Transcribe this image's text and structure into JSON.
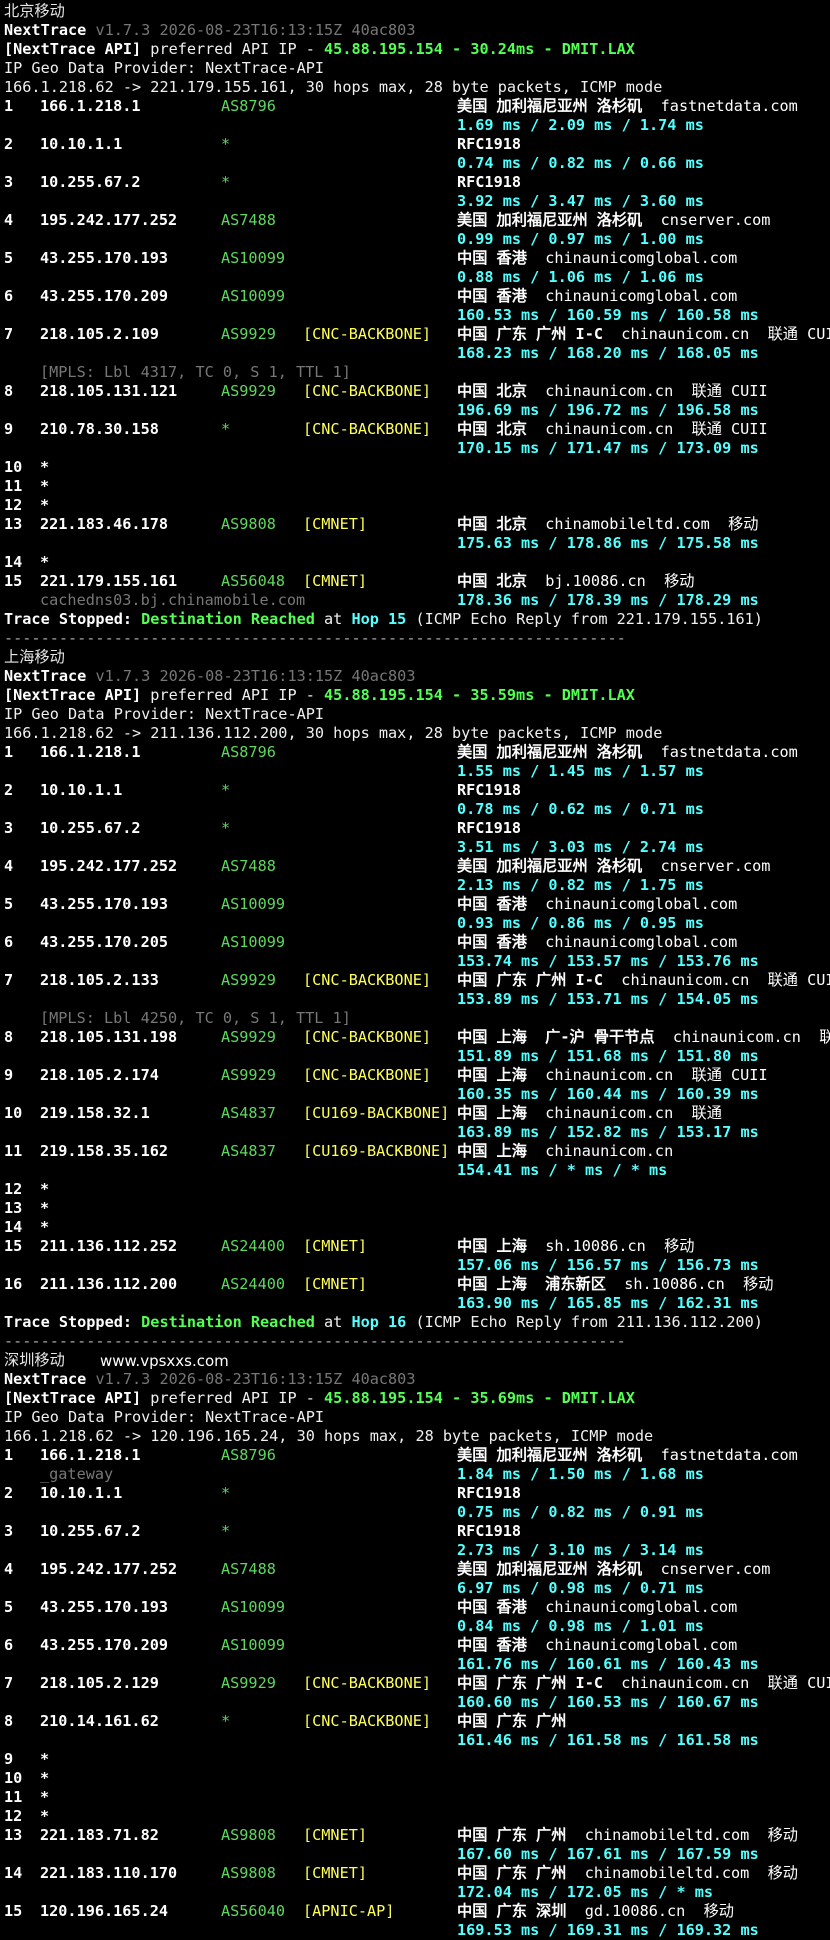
{
  "colors": {
    "bg": "#000000",
    "asn": "#5fd75f",
    "tag": "#ffff54",
    "latency": "#54ffff",
    "dim": "#777777"
  },
  "watermark": "www.vpsxxs.com",
  "sections": [
    {
      "title": "北京移动",
      "version": "v1.7.3 2026-08-23T16:13:15Z 40ac803",
      "api_prefix": "[NextTrace API]",
      "api_mid": " preferred API IP - ",
      "api_value": "45.88.195.154 - 30.24ms - DMIT.LAX",
      "geo_provider": "IP Geo Data Provider: NextTrace-API",
      "header": "166.1.218.62 -> 221.179.155.161, 30 hops max, 28 byte packets, ICMP mode",
      "hops": [
        {
          "n": "1",
          "ip": "166.1.218.1",
          "as": "AS8796",
          "tag": "",
          "geo": "美国 加利福尼亚州 洛杉矶",
          "host": "fastnetdata.com",
          "lat": "1.69 ms / 2.09 ms / 1.74 ms"
        },
        {
          "n": "2",
          "ip": "10.10.1.1",
          "as": "*",
          "tag": "",
          "geo": "RFC1918",
          "host": "",
          "lat": "0.74 ms / 0.82 ms / 0.66 ms"
        },
        {
          "n": "3",
          "ip": "10.255.67.2",
          "as": "*",
          "tag": "",
          "geo": "RFC1918",
          "host": "",
          "lat": "3.92 ms / 3.47 ms / 3.60 ms"
        },
        {
          "n": "4",
          "ip": "195.242.177.252",
          "as": "AS7488",
          "tag": "",
          "geo": "美国 加利福尼亚州 洛杉矶",
          "host": "cnserver.com",
          "lat": "0.99 ms / 0.97 ms / 1.00 ms"
        },
        {
          "n": "5",
          "ip": "43.255.170.193",
          "as": "AS10099",
          "tag": "",
          "geo": "中国 香港",
          "host": "chinaunicomglobal.com",
          "lat": "0.88 ms / 1.06 ms / 1.06 ms"
        },
        {
          "n": "6",
          "ip": "43.255.170.209",
          "as": "AS10099",
          "tag": "",
          "geo": "中国 香港",
          "host": "chinaunicomglobal.com",
          "lat": "160.53 ms / 160.59 ms / 160.58 ms"
        },
        {
          "n": "7",
          "ip": "218.105.2.109",
          "as": "AS9929",
          "tag": "[CNC-BACKBONE]",
          "geo": "中国 广东 广州 I-C",
          "host": "chinaunicom.cn  联通 CUII",
          "lat": "168.23 ms / 168.20 ms / 168.05 ms"
        },
        {
          "n": "8",
          "ip": "218.105.131.121",
          "as": "AS9929",
          "tag": "[CNC-BACKBONE]",
          "geo": "中国 北京",
          "host": "chinaunicom.cn  联通 CUII",
          "lat": "196.69 ms / 196.72 ms / 196.58 ms",
          "mpls": "[MPLS: Lbl 4317, TC 0, S 1, TTL 1]"
        },
        {
          "n": "9",
          "ip": "210.78.30.158",
          "as": "*",
          "tag": "[CNC-BACKBONE]",
          "geo": "中国 北京",
          "host": "chinaunicom.cn  联通 CUII",
          "lat": "170.15 ms / 171.47 ms / 173.09 ms"
        },
        {
          "n": "10",
          "ip": "*",
          "star": true
        },
        {
          "n": "11",
          "ip": "*",
          "star": true
        },
        {
          "n": "12",
          "ip": "*",
          "star": true
        },
        {
          "n": "13",
          "ip": "221.183.46.178",
          "as": "AS9808",
          "tag": "[CMNET]",
          "geo": "中国 北京",
          "host": "chinamobileltd.com  移动",
          "lat": "175.63 ms / 178.86 ms / 175.58 ms"
        },
        {
          "n": "14",
          "ip": "*",
          "star": true
        },
        {
          "n": "15",
          "ip": "221.179.155.161",
          "as": "AS56048",
          "tag": "[CMNET]",
          "geo": "中国 北京",
          "host": "bj.10086.cn  移动",
          "lat": "178.36 ms / 178.39 ms / 178.29 ms",
          "rdns": "cachedns03.bj.chinamobile.com"
        }
      ],
      "stop_a": "Trace Stopped: ",
      "stop_b": "Destination Reached",
      "stop_c": " at ",
      "stop_d": "Hop 15",
      "stop_e": " (ICMP Echo Reply from 221.179.155.161)",
      "separator": "--------------------------------------------------------------------"
    },
    {
      "title": "上海移动",
      "version": "v1.7.3 2026-08-23T16:13:15Z 40ac803",
      "api_prefix": "[NextTrace API]",
      "api_mid": " preferred API IP - ",
      "api_value": "45.88.195.154 - 35.59ms - DMIT.LAX",
      "geo_provider": "IP Geo Data Provider: NextTrace-API",
      "header": "166.1.218.62 -> 211.136.112.200, 30 hops max, 28 byte packets, ICMP mode",
      "hops": [
        {
          "n": "1",
          "ip": "166.1.218.1",
          "as": "AS8796",
          "tag": "",
          "geo": "美国 加利福尼亚州 洛杉矶",
          "host": "fastnetdata.com",
          "lat": "1.55 ms / 1.45 ms / 1.57 ms"
        },
        {
          "n": "2",
          "ip": "10.10.1.1",
          "as": "*",
          "tag": "",
          "geo": "RFC1918",
          "host": "",
          "lat": "0.78 ms / 0.62 ms / 0.71 ms"
        },
        {
          "n": "3",
          "ip": "10.255.67.2",
          "as": "*",
          "tag": "",
          "geo": "RFC1918",
          "host": "",
          "lat": "3.51 ms / 3.03 ms / 2.74 ms"
        },
        {
          "n": "4",
          "ip": "195.242.177.252",
          "as": "AS7488",
          "tag": "",
          "geo": "美国 加利福尼亚州 洛杉矶",
          "host": "cnserver.com",
          "lat": "2.13 ms / 0.82 ms / 1.75 ms"
        },
        {
          "n": "5",
          "ip": "43.255.170.193",
          "as": "AS10099",
          "tag": "",
          "geo": "中国 香港",
          "host": "chinaunicomglobal.com",
          "lat": "0.93 ms / 0.86 ms / 0.95 ms"
        },
        {
          "n": "6",
          "ip": "43.255.170.205",
          "as": "AS10099",
          "tag": "",
          "geo": "中国 香港",
          "host": "chinaunicomglobal.com",
          "lat": "153.74 ms / 153.57 ms / 153.76 ms"
        },
        {
          "n": "7",
          "ip": "218.105.2.133",
          "as": "AS9929",
          "tag": "[CNC-BACKBONE]",
          "geo": "中国 广东 广州 I-C",
          "host": "chinaunicom.cn  联通 CUII",
          "lat": "153.89 ms / 153.71 ms / 154.05 ms"
        },
        {
          "n": "8",
          "ip": "218.105.131.198",
          "as": "AS9929",
          "tag": "[CNC-BACKBONE]",
          "geo": "中国 上海  广-沪 骨干节点",
          "host": "chinaunicom.cn  联通",
          "lat": "151.89 ms / 151.68 ms / 151.80 ms",
          "mpls": "[MPLS: Lbl 4250, TC 0, S 1, TTL 1]"
        },
        {
          "n": "9",
          "ip": "218.105.2.174",
          "as": "AS9929",
          "tag": "[CNC-BACKBONE]",
          "geo": "中国 上海",
          "host": "chinaunicom.cn  联通 CUII",
          "lat": "160.35 ms / 160.44 ms / 160.39 ms"
        },
        {
          "n": "10",
          "ip": "219.158.32.1",
          "as": "AS4837",
          "tag": "[CU169-BACKBONE]",
          "geo": "中国 上海",
          "host": "chinaunicom.cn  联通",
          "lat": "163.89 ms / 152.82 ms / 153.17 ms"
        },
        {
          "n": "11",
          "ip": "219.158.35.162",
          "as": "AS4837",
          "tag": "[CU169-BACKBONE]",
          "geo": "中国 上海",
          "host": "chinaunicom.cn",
          "lat": "154.41 ms / * ms / * ms"
        },
        {
          "n": "12",
          "ip": "*",
          "star": true
        },
        {
          "n": "13",
          "ip": "*",
          "star": true
        },
        {
          "n": "14",
          "ip": "*",
          "star": true
        },
        {
          "n": "15",
          "ip": "211.136.112.252",
          "as": "AS24400",
          "tag": "[CMNET]",
          "geo": "中国 上海",
          "host": "sh.10086.cn  移动",
          "lat": "157.06 ms / 156.57 ms / 156.73 ms"
        },
        {
          "n": "16",
          "ip": "211.136.112.200",
          "as": "AS24400",
          "tag": "[CMNET]",
          "geo": "中国 上海  浦东新区",
          "host": "sh.10086.cn  移动",
          "lat": "163.90 ms / 165.85 ms / 162.31 ms"
        }
      ],
      "stop_a": "Trace Stopped: ",
      "stop_b": "Destination Reached",
      "stop_c": " at ",
      "stop_d": "Hop 16",
      "stop_e": " (ICMP Echo Reply from 211.136.112.200)",
      "separator": "--------------------------------------------------------------------"
    },
    {
      "title": "深圳移动",
      "version": "v1.7.3 2026-08-23T16:13:15Z 40ac803",
      "api_prefix": "[NextTrace API]",
      "api_mid": " preferred API IP - ",
      "api_value": "45.88.195.154 - 35.69ms - DMIT.LAX",
      "geo_provider": "IP Geo Data Provider: NextTrace-API",
      "header": "166.1.218.62 -> 120.196.165.24, 30 hops max, 28 byte packets, ICMP mode",
      "hops": [
        {
          "n": "1",
          "ip": "166.1.218.1",
          "as": "AS8796",
          "tag": "",
          "geo": "美国 加利福尼亚州 洛杉矶",
          "host": "fastnetdata.com",
          "lat": "1.84 ms / 1.50 ms / 1.68 ms",
          "rdns": "_gateway"
        },
        {
          "n": "2",
          "ip": "10.10.1.1",
          "as": "*",
          "tag": "",
          "geo": "RFC1918",
          "host": "",
          "lat": "0.75 ms / 0.82 ms / 0.91 ms"
        },
        {
          "n": "3",
          "ip": "10.255.67.2",
          "as": "*",
          "tag": "",
          "geo": "RFC1918",
          "host": "",
          "lat": "2.73 ms / 3.10 ms / 3.14 ms"
        },
        {
          "n": "4",
          "ip": "195.242.177.252",
          "as": "AS7488",
          "tag": "",
          "geo": "美国 加利福尼亚州 洛杉矶",
          "host": "cnserver.com",
          "lat": "6.97 ms / 0.98 ms / 0.71 ms"
        },
        {
          "n": "5",
          "ip": "43.255.170.193",
          "as": "AS10099",
          "tag": "",
          "geo": "中国 香港",
          "host": "chinaunicomglobal.com",
          "lat": "0.84 ms / 0.98 ms / 1.01 ms"
        },
        {
          "n": "6",
          "ip": "43.255.170.209",
          "as": "AS10099",
          "tag": "",
          "geo": "中国 香港",
          "host": "chinaunicomglobal.com",
          "lat": "161.76 ms / 160.61 ms / 160.43 ms"
        },
        {
          "n": "7",
          "ip": "218.105.2.129",
          "as": "AS9929",
          "tag": "[CNC-BACKBONE]",
          "geo": "中国 广东 广州 I-C",
          "host": "chinaunicom.cn  联通 CUII",
          "lat": "160.60 ms / 160.53 ms / 160.67 ms"
        },
        {
          "n": "8",
          "ip": "210.14.161.62",
          "as": "*",
          "tag": "[CNC-BACKBONE]",
          "geo": "中国 广东 广州",
          "host": "",
          "lat": "161.46 ms / 161.58 ms / 161.58 ms"
        },
        {
          "n": "9",
          "ip": "*",
          "star": true
        },
        {
          "n": "10",
          "ip": "*",
          "star": true
        },
        {
          "n": "11",
          "ip": "*",
          "star": true
        },
        {
          "n": "12",
          "ip": "*",
          "star": true
        },
        {
          "n": "13",
          "ip": "221.183.71.82",
          "as": "AS9808",
          "tag": "[CMNET]",
          "geo": "中国 广东 广州",
          "host": "chinamobileltd.com  移动",
          "lat": "167.60 ms / 167.61 ms / 167.59 ms"
        },
        {
          "n": "14",
          "ip": "221.183.110.170",
          "as": "AS9808",
          "tag": "[CMNET]",
          "geo": "中国 广东 广州",
          "host": "chinamobileltd.com  移动",
          "lat": "172.04 ms / 172.05 ms / * ms"
        },
        {
          "n": "15",
          "ip": "120.196.165.24",
          "as": "AS56040",
          "tag": "[APNIC-AP]",
          "geo": "中国 广东 深圳",
          "host": "gd.10086.cn  移动",
          "lat": "169.53 ms / 169.31 ms / 169.32 ms"
        }
      ]
    }
  ]
}
